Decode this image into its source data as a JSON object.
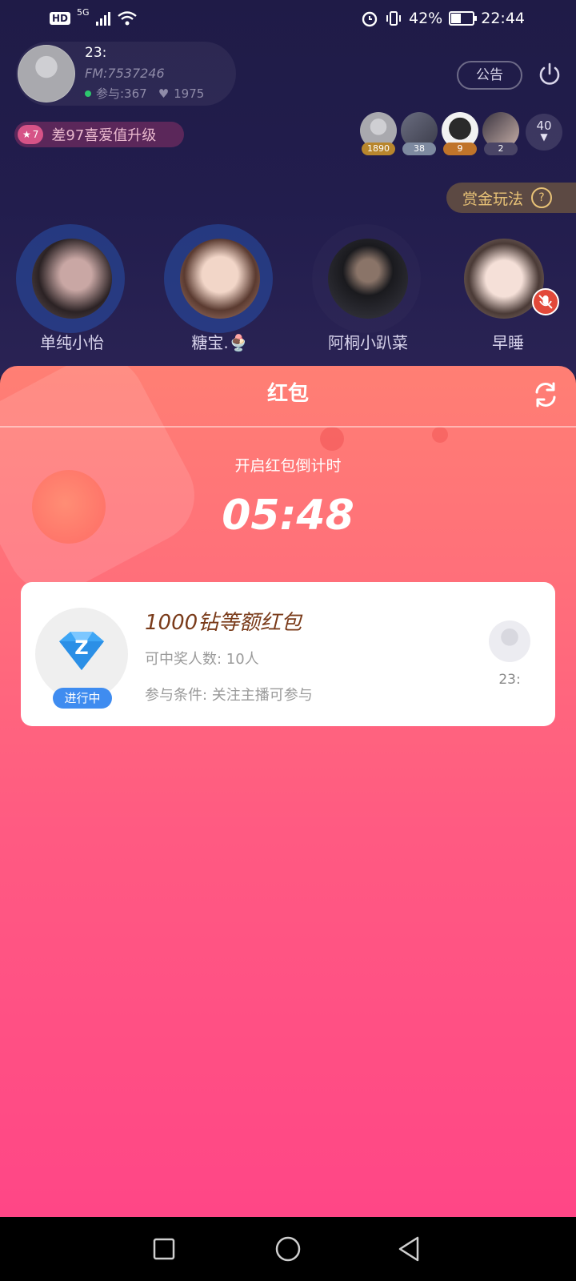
{
  "status_bar": {
    "network": "5G",
    "hd": "HD",
    "battery": "42%",
    "time": "22:44"
  },
  "host": {
    "name": "23:",
    "fm_id": "FM:7537246",
    "participation": "参与:367",
    "likes": "1975"
  },
  "header": {
    "notice_label": "公告"
  },
  "level": {
    "badge": "7",
    "text": "差97喜爱值升级"
  },
  "viewers": {
    "items": [
      {
        "tag": "1890",
        "tag_color": "#b8862d"
      },
      {
        "tag": "38",
        "tag_color": "#7e8aa0"
      },
      {
        "tag": "9",
        "tag_color": "#c0742a"
      },
      {
        "tag": "2",
        "tag_color": "#4a4566"
      }
    ],
    "count": "40"
  },
  "bounty": {
    "label": "赏金玩法",
    "help": "?"
  },
  "seats": [
    {
      "name": "单纯小怡"
    },
    {
      "name": "糖宝.🍨"
    },
    {
      "name": "阿桐小趴菜"
    },
    {
      "name": "早睡"
    }
  ],
  "red_packet_sheet": {
    "title": "红包",
    "countdown_label": "开启红包倒计时",
    "countdown": "05:48",
    "packet": {
      "title": "1000钻等额红包",
      "winners": "可中奖人数: 10人",
      "condition": "参与条件: 关注主播可参与",
      "status": "进行中",
      "diamond_letter": "Z",
      "sender": "23:"
    }
  },
  "colors": {
    "sheet_top": "#ff7f74",
    "sheet_bottom": "#ff4686",
    "accent_blue": "#3f8cf0",
    "bounty_gold": "#e8c277",
    "room_bg": "#1f1b47"
  }
}
